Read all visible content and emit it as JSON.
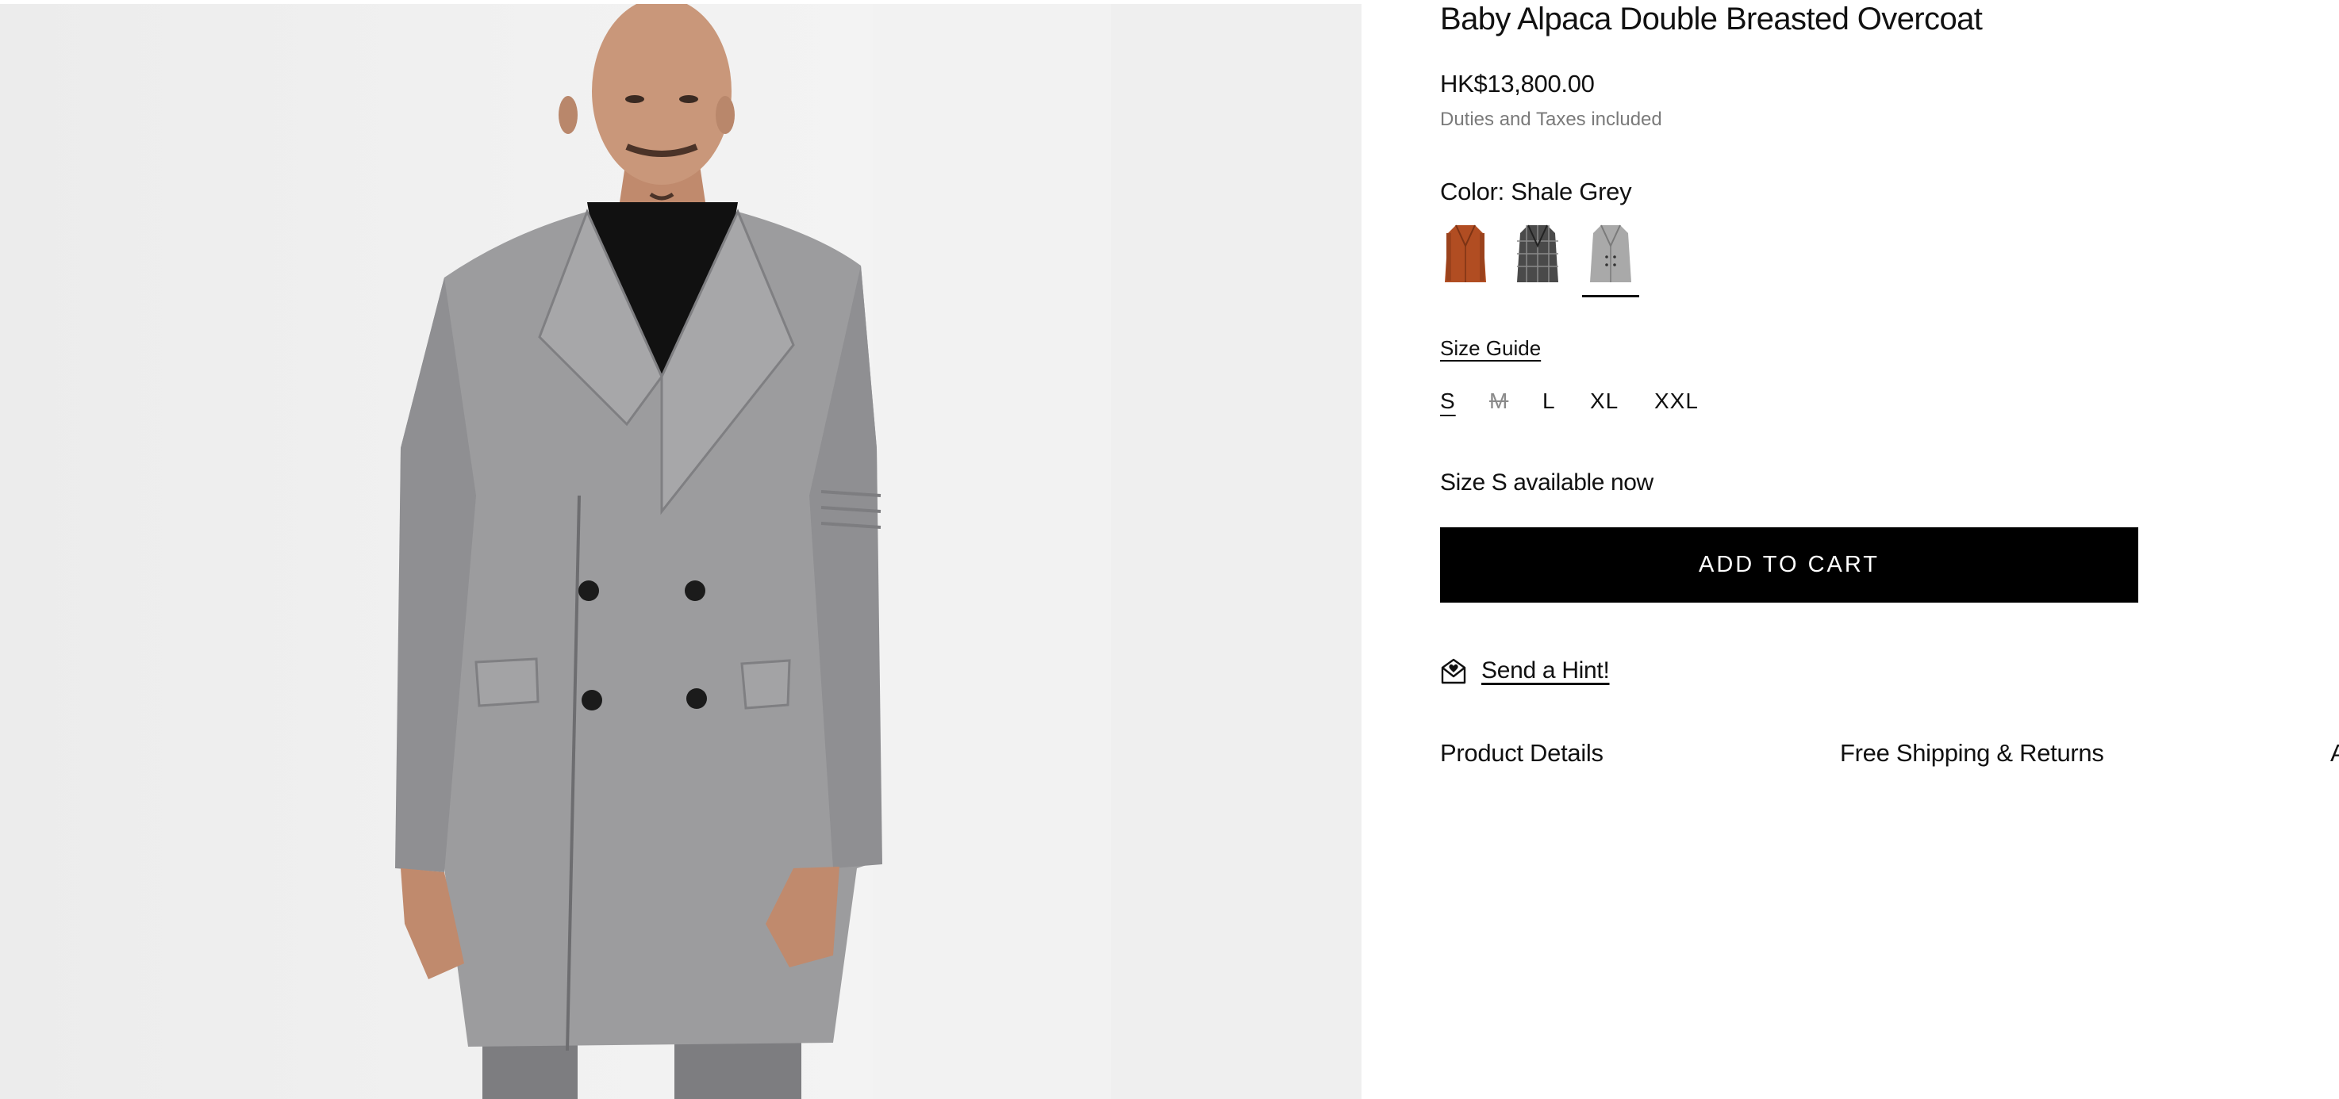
{
  "product": {
    "title": "Baby Alpaca Double Breasted Overcoat",
    "price": "HK$13,800.00",
    "tax_note": "Duties and Taxes included",
    "image_alt": "Baby Alpaca Double Breasted Overcoat in Shale Grey"
  },
  "color": {
    "label": "Color: Shale Grey",
    "swatches": [
      {
        "name": "Rust",
        "color": "#b14d22",
        "selected": false
      },
      {
        "name": "Charcoal Check",
        "color": "#4a4a4a",
        "selected": false
      },
      {
        "name": "Shale Grey",
        "color": "#a9a9a9",
        "selected": true
      }
    ]
  },
  "size": {
    "guide_label": "Size Guide",
    "options": [
      {
        "label": "S",
        "selected": true,
        "available": true
      },
      {
        "label": "M",
        "selected": false,
        "available": false
      },
      {
        "label": "L",
        "selected": false,
        "available": true
      },
      {
        "label": "XL",
        "selected": false,
        "available": true
      },
      {
        "label": "XXL",
        "selected": false,
        "available": true
      }
    ],
    "availability": "Size S available now"
  },
  "cart": {
    "add_label": "ADD TO CART"
  },
  "hint": {
    "label": "Send a Hint!",
    "icon": "envelope-heart-icon"
  },
  "tabs": [
    {
      "label": "Product Details"
    },
    {
      "label": "Free Shipping & Returns"
    },
    {
      "label": "A"
    }
  ],
  "colors": {
    "accent": "#000000",
    "muted_text": "#7a7a7a"
  }
}
